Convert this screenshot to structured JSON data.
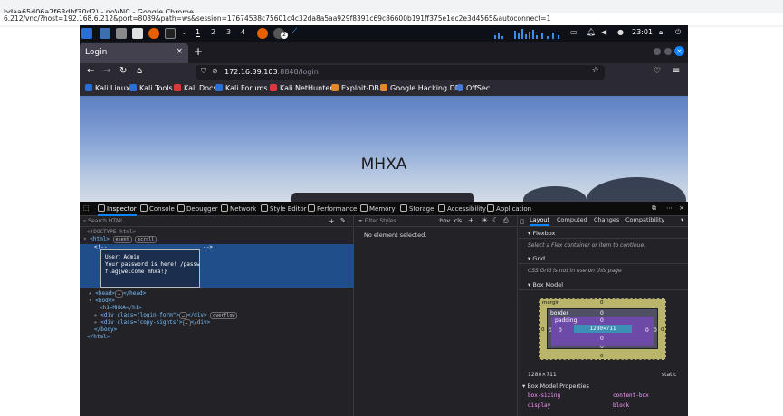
{
  "outer": {
    "title": "bdaa65d06a7f63dbf30d2) - noVNC - Google Chrome",
    "url": "6.212/vnc/?host=192.168.6.212&port=8089&path=ws&session=17674538c75601c4c32da8a5aa929f8391c69c86600b191ff375e1ec2e3d4565&autoconnect=1"
  },
  "taskbar": {
    "workspaces": [
      "1",
      "2",
      "3",
      "4"
    ],
    "clock": "23:01",
    "badge": "2"
  },
  "browser": {
    "tab_title": "Login",
    "url_host": "172.16.39.103",
    "url_rest": ":8848/login",
    "bookmarks": [
      "Kali Linux",
      "Kali Tools",
      "Kali Docs",
      "Kali Forums",
      "Kali NetHunter",
      "Exploit-DB",
      "Google Hacking DB",
      "OffSec"
    ]
  },
  "page": {
    "heading": "MHXA"
  },
  "devtools": {
    "tabs": [
      "Inspector",
      "Console",
      "Debugger",
      "Network",
      "Style Editor",
      "Performance",
      "Memory",
      "Storage",
      "Accessibility",
      "Application"
    ],
    "search_placeholder": "Search HTML",
    "filter_placeholder": "Filter Styles",
    "hov": ":hov",
    "cls": ".cls",
    "right_tabs": [
      "Layout",
      "Computed",
      "Changes",
      "Compatibility"
    ],
    "html": {
      "doctype": "<!DOCTYPE html>",
      "html_open": "<html>",
      "event": "event",
      "scroll": "scroll",
      "comment_open": "<!--",
      "comment_close": "-->",
      "tooltip_lines": [
        "User：Admin",
        "Your password is here! /passwd",
        "flag{welcome mhxa!}"
      ],
      "head": "<head>",
      "head_close": "</head>",
      "body_open": "<body>",
      "h1": "<h1>MHXA</h1>",
      "div1_open": "<div class=\"login-form\">",
      "div1_close": "</div>",
      "overflow": "overflow",
      "div2_open": "<div class=\"copy-sights\">",
      "div2_close": "</div>",
      "body_close": "</body>",
      "html_close": "</html>",
      "ellipsis": "…"
    },
    "rules_empty": "No element selected.",
    "flexbox": {
      "title": "Flexbox",
      "note": "Select a Flex container or item to continue."
    },
    "grid": {
      "title": "Grid",
      "note": "CSS Grid is not in use on this page"
    },
    "boxmodel": {
      "title": "Box Model",
      "margin": "margin",
      "border": "border",
      "padding": "padding",
      "content": "1280×711",
      "zero": "0",
      "size": "1280×711",
      "position": "static"
    },
    "boxprops": {
      "title": "Box Model Properties",
      "rows": [
        {
          "name": "box-sizing",
          "value": "content-box"
        },
        {
          "name": "display",
          "value": "block"
        }
      ]
    }
  }
}
